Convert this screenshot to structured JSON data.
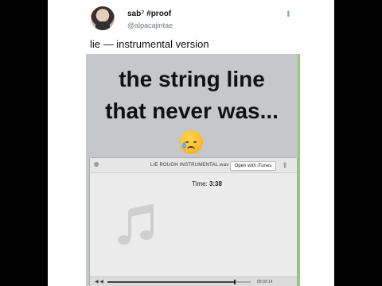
{
  "tweet": {
    "display_name": "sab⁷ #proof",
    "handle": "@alpacajintae",
    "text": "lie — instrumental version",
    "more_icon": "more-dots-icon"
  },
  "media": {
    "caption_line1": "the string line",
    "caption_line2": "that never was...",
    "emoji": "crying-face-emoji",
    "player": {
      "file_name": "LIE ROUGH INSTRUMENTAL.wav",
      "open_button": "Open with iTunes",
      "time_label": "Time:",
      "time_value": "3:38",
      "left_controls": "◀ ◀",
      "right_time": "00:03:14",
      "progress": 0.89
    }
  }
}
